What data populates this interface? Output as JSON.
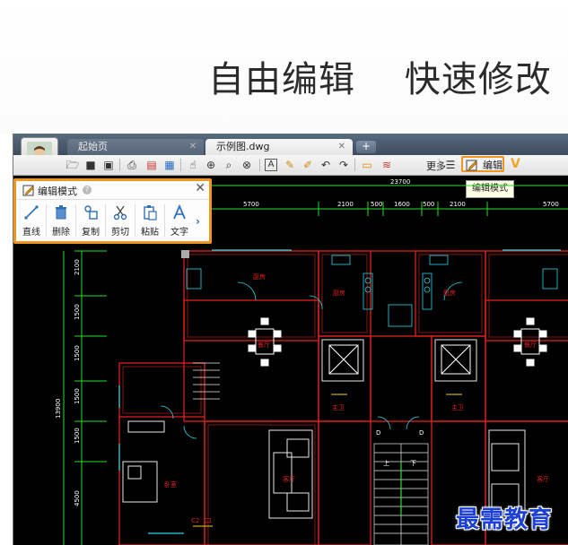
{
  "headline": "自由编辑    快速修改",
  "tabs": [
    {
      "label": "起始页"
    },
    {
      "label": "示例图.dwg"
    }
  ],
  "toolbar": {
    "more_label": "更多",
    "edit_label": "编辑",
    "tooltip": "编辑模式"
  },
  "panel": {
    "title": "编辑模式",
    "buttons": [
      {
        "label": "直线"
      },
      {
        "label": "删除"
      },
      {
        "label": "复制"
      },
      {
        "label": "剪切"
      },
      {
        "label": "粘贴"
      },
      {
        "label": "文字"
      }
    ]
  },
  "cad": {
    "top_dims": [
      "23700",
      "5700",
      "2100",
      "500",
      "1600",
      "500",
      "2100",
      "5700"
    ],
    "left_dims": [
      "2100",
      "1500",
      "1500",
      "1500",
      "1500",
      "13900",
      "4500"
    ],
    "rooms": [
      "厨房",
      "厨房",
      "厨房",
      "餐厅",
      "餐厅",
      "客厅",
      "客厅",
      "卧室",
      "主卫",
      "主卫"
    ],
    "small_labels": [
      "D",
      "D",
      "上",
      "下",
      "C2",
      "C1"
    ]
  },
  "watermark": "最需教育",
  "colors": {
    "accent_orange": "#f0951f",
    "cad_background": "#000000",
    "wall_red": "#e02020",
    "cyan": "#27d7e8",
    "green": "#22e022",
    "watermark_blue": "#1c3fd4"
  }
}
